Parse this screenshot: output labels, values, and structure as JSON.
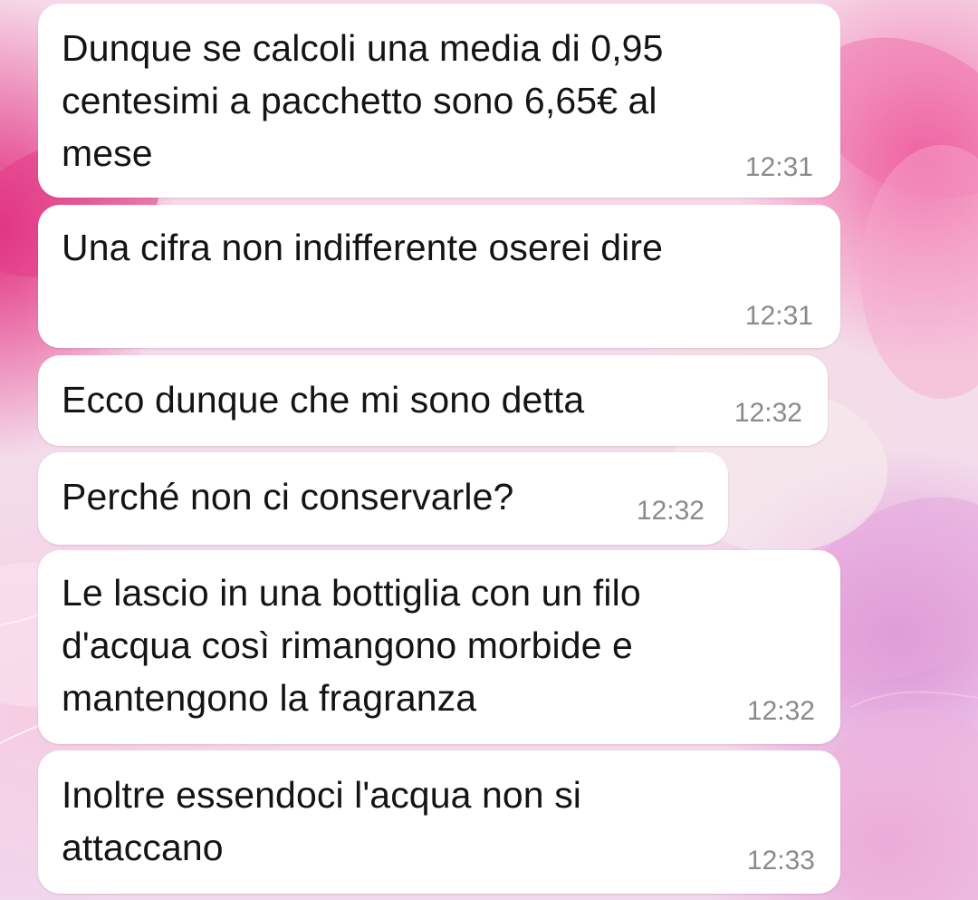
{
  "conversation": {
    "messages": [
      {
        "text": "Dunque se calcoli una media di 0,95\ncentesimi a pacchetto sono 6,65€ al\nmese",
        "time": "12:31"
      },
      {
        "text": "Una cifra non indifferente oserei dire",
        "time": "12:31"
      },
      {
        "text": "Ecco dunque che mi sono detta",
        "time": "12:32"
      },
      {
        "text": "Perché non ci conservarle?",
        "time": "12:32"
      },
      {
        "text": "Le lascio in una bottiglia con un filo\nd'acqua così rimangono morbide e\nmantengono la fragranza",
        "time": "12:32"
      },
      {
        "text": "Inoltre essendoci l'acqua non si\nattaccano",
        "time": "12:33"
      }
    ]
  },
  "colors": {
    "bubble": "#ffffff",
    "text": "#141414",
    "timestamp": "#8a8a8a",
    "wallpaper_accent": "#e0307e"
  },
  "icons": {
    "wallpaper": "pink-flower-wallpaper"
  }
}
